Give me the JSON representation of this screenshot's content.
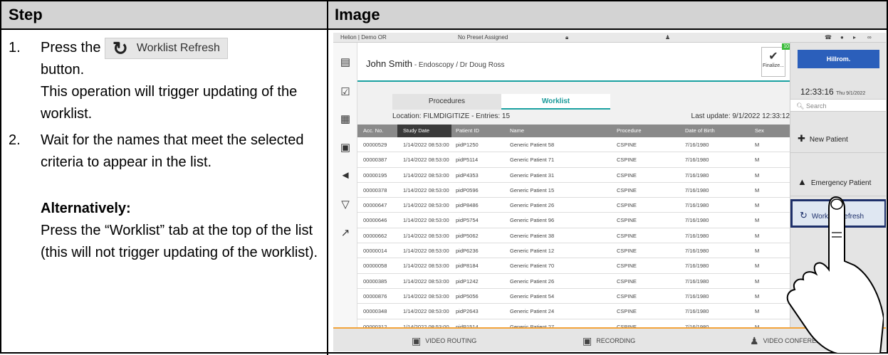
{
  "header": {
    "step": "Step",
    "image": "Image"
  },
  "steps": [
    {
      "num": "1.",
      "pre": "Press the",
      "button_label": "Worklist Refresh",
      "post_lines": [
        "button.",
        "This operation will trigger updating of the worklist."
      ]
    },
    {
      "num": "2.",
      "text": "Wait for the names that meet the selected criteria to appear in the list."
    }
  ],
  "alternatively": {
    "title": "Alternatively:",
    "text": "Press the “Worklist” tab at the top of the list (this will not trigger updating of the worklist)."
  },
  "screen": {
    "topbar": {
      "room": "Helion | Demo OR",
      "preset": "No Preset Assigned"
    },
    "patient": {
      "name": "John Smith",
      "details": " - Endoscopy / Dr Doug Ross",
      "finalize": "Finalize...",
      "badge": "10"
    },
    "tabs": {
      "procedures": "Procedures",
      "worklist": "Worklist"
    },
    "location": "Location: FILMDIGITIZE - Entries: 15",
    "last_update": "Last update: 9/1/2022 12:33:12",
    "columns": [
      "Acc. No.",
      "Study Date",
      "Patient ID",
      "Name",
      "Procedure",
      "Date of Birth",
      "Sex"
    ],
    "rows": [
      [
        "00000529",
        "1/14/2022 08:53:00",
        "pidP1250",
        "Generic Patient 58",
        "CSPINE",
        "7/16/1980",
        "M"
      ],
      [
        "00000387",
        "1/14/2022 08:53:00",
        "pidP5114",
        "Generic Patient 71",
        "CSPINE",
        "7/16/1980",
        "M"
      ],
      [
        "00000195",
        "1/14/2022 08:53:00",
        "pidP4353",
        "Generic Patient 31",
        "CSPINE",
        "7/16/1980",
        "M"
      ],
      [
        "00000378",
        "1/14/2022 08:53:00",
        "pidP0596",
        "Generic Patient 15",
        "CSPINE",
        "7/16/1980",
        "M"
      ],
      [
        "00000647",
        "1/14/2022 08:53:00",
        "pidP8486",
        "Generic Patient 26",
        "CSPINE",
        "7/16/1980",
        "M"
      ],
      [
        "00000646",
        "1/14/2022 08:53:00",
        "pidP5754",
        "Generic Patient 96",
        "CSPINE",
        "7/16/1980",
        "M"
      ],
      [
        "00000662",
        "1/14/2022 08:53:00",
        "pidP5062",
        "Generic Patient 38",
        "CSPINE",
        "7/16/1980",
        "M"
      ],
      [
        "00000014",
        "1/14/2022 08:53:00",
        "pidP6236",
        "Generic Patient 12",
        "CSPINE",
        "7/16/1980",
        "M"
      ],
      [
        "00000058",
        "1/14/2022 08:53:00",
        "pidP8184",
        "Generic Patient 70",
        "CSPINE",
        "7/16/1980",
        "M"
      ],
      [
        "00000385",
        "1/14/2022 08:53:00",
        "pidP1242",
        "Generic Patient 26",
        "CSPINE",
        "7/16/1980",
        "M"
      ],
      [
        "00000876",
        "1/14/2022 08:53:00",
        "pidP5056",
        "Generic Patient 54",
        "CSPINE",
        "7/16/1980",
        "M"
      ],
      [
        "00000348",
        "1/14/2022 08:53:00",
        "pidP2643",
        "Generic Patient 24",
        "CSPINE",
        "7/16/1980",
        "M"
      ],
      [
        "00000312",
        "1/14/2022 08:53:00",
        "pidP1514",
        "Generic Patient 27",
        "CSPINE",
        "7/16/1980",
        "M"
      ]
    ],
    "right": {
      "logo": "Hillrom.",
      "time": "12:33:16",
      "date": "Thu 9/1/2022",
      "search": "Search",
      "new_patient": "New Patient",
      "emergency": "Emergency Patient",
      "refresh": "Worklist Refresh"
    },
    "bottom": {
      "video_routing": "VIDEO ROUTING",
      "recording": "RECORDING",
      "video_conf": "VIDEO CONFEREN"
    }
  }
}
